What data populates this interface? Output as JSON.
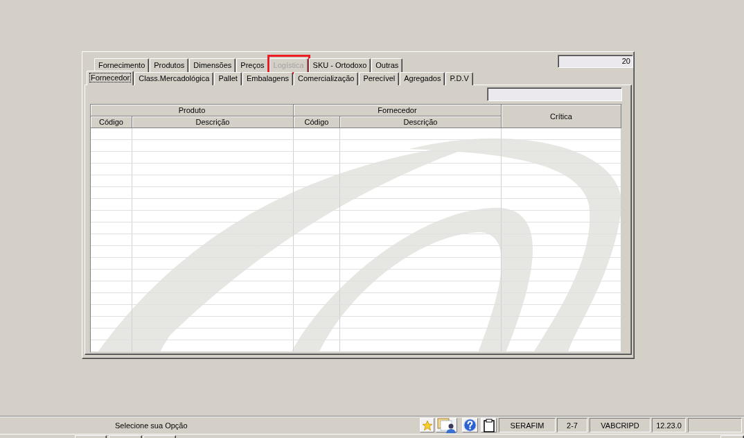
{
  "tab_rows": [
    {
      "tabs": [
        {
          "label": "Fornecimento",
          "selected": false,
          "disabled": false,
          "highlighted": false
        },
        {
          "label": "Produtos",
          "selected": false,
          "disabled": false,
          "highlighted": false
        },
        {
          "label": "Dimensões",
          "selected": false,
          "disabled": false,
          "highlighted": false
        },
        {
          "label": "Preços",
          "selected": false,
          "disabled": false,
          "highlighted": false
        },
        {
          "label": "Logística",
          "selected": false,
          "disabled": true,
          "highlighted": true
        },
        {
          "label": "SKU - Ortodoxo",
          "selected": false,
          "disabled": false,
          "highlighted": false
        },
        {
          "label": "Outras",
          "selected": false,
          "disabled": false,
          "highlighted": false
        }
      ]
    },
    {
      "tabs": [
        {
          "label": "Fornecedor",
          "selected": true,
          "disabled": false,
          "highlighted": false
        },
        {
          "label": "Class.Mercadológica",
          "selected": false,
          "disabled": false,
          "highlighted": false
        },
        {
          "label": "Pallet",
          "selected": false,
          "disabled": false,
          "highlighted": false
        },
        {
          "label": "Embalagens",
          "selected": false,
          "disabled": false,
          "highlighted": false
        },
        {
          "label": "Comercialização",
          "selected": false,
          "disabled": false,
          "highlighted": false
        },
        {
          "label": "Perecível",
          "selected": false,
          "disabled": false,
          "highlighted": false
        },
        {
          "label": "Agregados",
          "selected": false,
          "disabled": false,
          "highlighted": false
        },
        {
          "label": "P.D.V",
          "selected": false,
          "disabled": false,
          "highlighted": false
        }
      ]
    }
  ],
  "record_count": {
    "value": "20"
  },
  "table": {
    "column_groups": [
      {
        "label": "Produto",
        "columns": [
          "Código",
          "Descrição"
        ]
      },
      {
        "label": "Fornecedor",
        "columns": [
          "Código",
          "Descrição"
        ]
      },
      {
        "label": "Crítica"
      }
    ]
  },
  "status_bar": {
    "message": "Selecione sua Opção",
    "fields": [
      "SERAFIM",
      "2-7",
      "VABCRIPD",
      "12.23.0"
    ]
  }
}
